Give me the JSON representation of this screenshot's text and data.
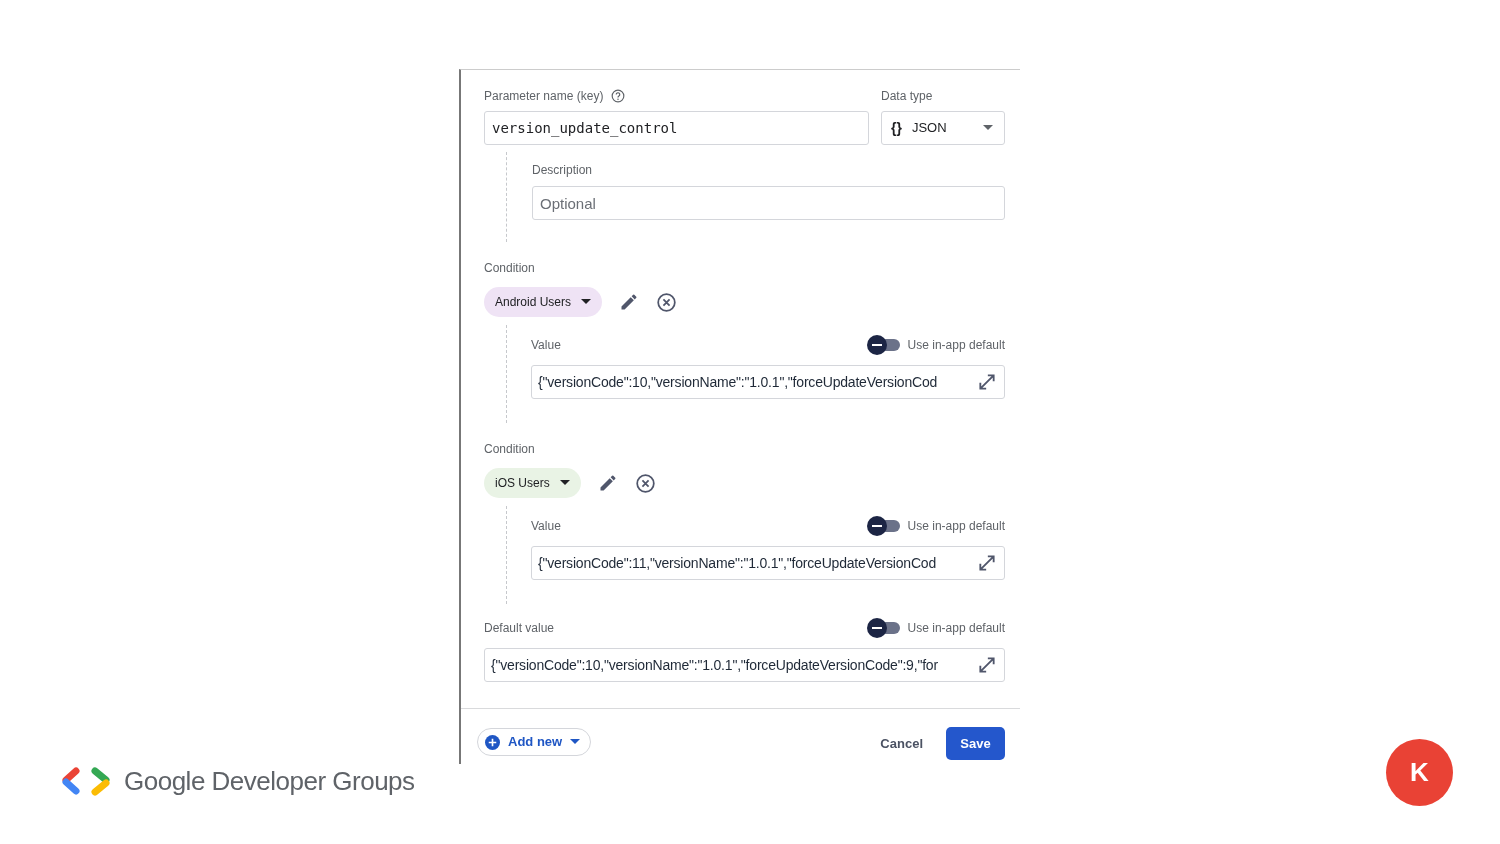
{
  "parameter": {
    "label": "Parameter name (key)",
    "value": "version_update_control"
  },
  "data_type": {
    "label": "Data type",
    "icon": "{}",
    "value": "JSON"
  },
  "description": {
    "label": "Description",
    "placeholder": "Optional"
  },
  "conditions": [
    {
      "label": "Condition",
      "name": "Android Users",
      "color": "#efe3f5",
      "value_label": "Value",
      "toggle_label": "Use in-app default",
      "use_default": false,
      "value": "{\"versionCode\":10,\"versionName\":\"1.0.1\",\"forceUpdateVersionCod"
    },
    {
      "label": "Condition",
      "name": "iOS Users",
      "color": "#e9f3e5",
      "value_label": "Value",
      "toggle_label": "Use in-app default",
      "use_default": false,
      "value": "{\"versionCode\":11,\"versionName\":\"1.0.1\",\"forceUpdateVersionCod"
    }
  ],
  "default_value": {
    "label": "Default value",
    "toggle_label": "Use in-app default",
    "use_default": false,
    "value": "{\"versionCode\":10,\"versionName\":\"1.0.1\",\"forceUpdateVersionCode\":9,\"for"
  },
  "footer": {
    "add_new": "Add new",
    "cancel": "Cancel",
    "save": "Save"
  },
  "logo_text": "Google Developer Groups",
  "avatar": "K"
}
